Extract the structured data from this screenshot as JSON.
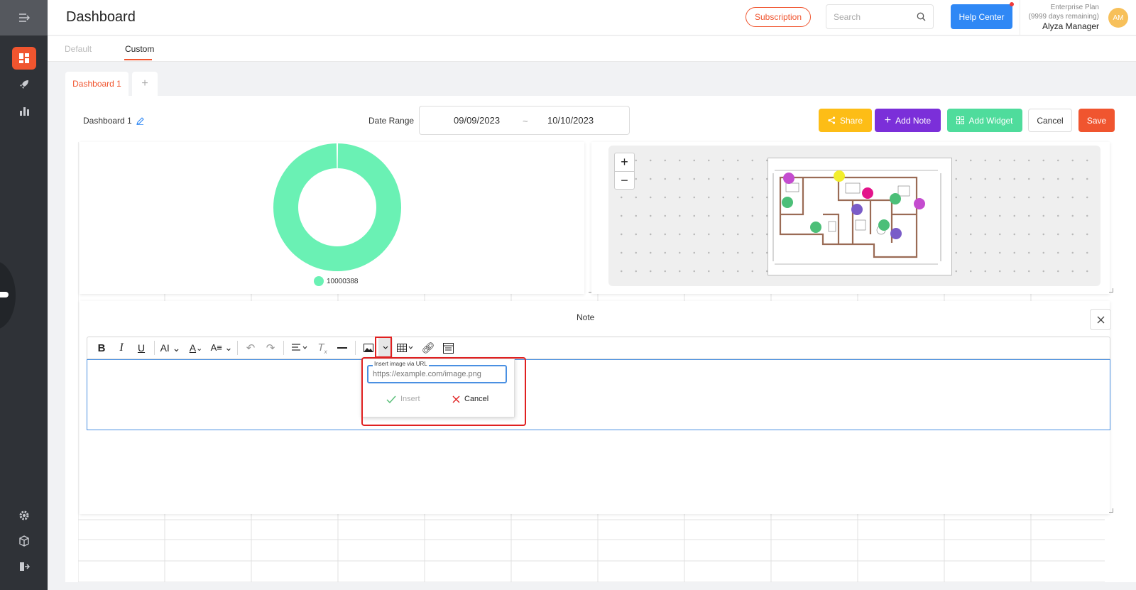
{
  "header": {
    "title": "Dashboard",
    "subscription_label": "Subscription",
    "search_placeholder": "Search",
    "help_label": "Help Center",
    "plan_name": "Enterprise Plan",
    "plan_days": "(9999 days remaining)",
    "user_name": "Alyza Manager",
    "avatar_initials": "AM"
  },
  "top_tabs": [
    {
      "label": "Default",
      "active": false
    },
    {
      "label": "Custom",
      "active": true
    }
  ],
  "dashboard_tabs": {
    "current": "Dashboard 1",
    "add": "+"
  },
  "toolbar_row": {
    "dashboard_name": "Dashboard 1",
    "date_range_label": "Date Range",
    "date_start": "09/09/2023",
    "date_sep": "~",
    "date_end": "10/10/2023",
    "share_label": "Share",
    "add_note_label": "Add Note",
    "add_widget_label": "Add Widget",
    "cancel_label": "Cancel",
    "save_label": "Save"
  },
  "chart_data": {
    "type": "pie",
    "title": "",
    "categories": [
      "10000388"
    ],
    "values": [
      100
    ],
    "colors": [
      "#6af1b4"
    ],
    "legend": "bottom"
  },
  "map": {
    "zoom_in": "+",
    "zoom_out": "−",
    "markers": [
      {
        "color": "#c44ccf"
      },
      {
        "color": "#f2ee2c"
      },
      {
        "color": "#e3148a"
      },
      {
        "color": "#4cbf78"
      },
      {
        "color": "#c44ccf"
      },
      {
        "color": "#4cbf78"
      },
      {
        "color": "#7a5cc8"
      },
      {
        "color": "#4cbf78"
      },
      {
        "color": "#4cbf78"
      },
      {
        "color": "#7a5cc8"
      }
    ]
  },
  "note": {
    "title": "Note",
    "close": "×"
  },
  "image_popup": {
    "field_label": "Insert image via URL",
    "placeholder": "https://example.com/image.png",
    "insert_label": "Insert",
    "cancel_label": "Cancel"
  },
  "colors": {
    "accent": "#f0552f",
    "help_blue": "#2f88f5",
    "share_yellow": "#fdbd16",
    "note_purple": "#7b2fd9",
    "widget_green": "#4fdc9c",
    "sidebar_bg": "#2f3237"
  }
}
